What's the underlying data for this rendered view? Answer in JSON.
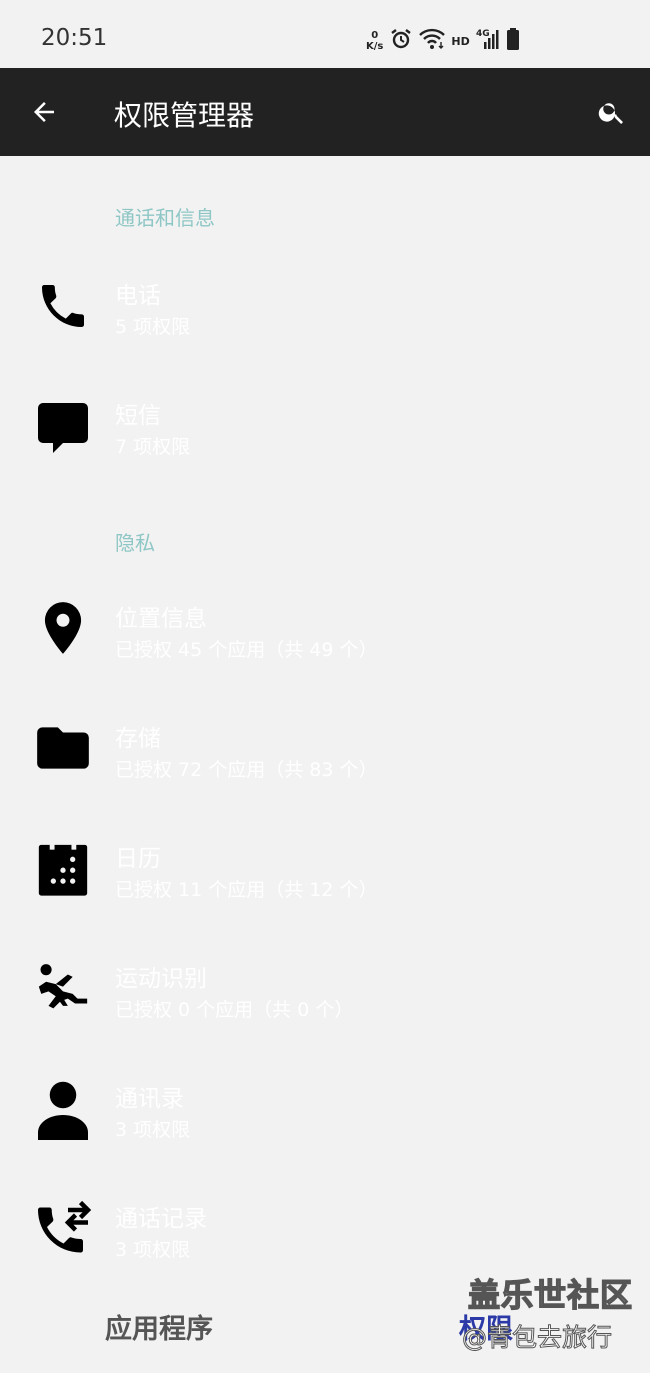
{
  "status_bar": {
    "time": "20:51",
    "net_speed_value": "0",
    "net_speed_unit": "K/s",
    "hd_label": "HD",
    "network_label": "4G"
  },
  "app_bar": {
    "title": "权限管理器",
    "background": "#222222"
  },
  "sections": [
    {
      "header": "通话和信息"
    },
    {
      "header": "隐私"
    }
  ],
  "permissions": [
    {
      "icon": "phone-icon",
      "title": "电话",
      "subtitle": "5 项权限"
    },
    {
      "icon": "sms-icon",
      "title": "短信",
      "subtitle": "7 项权限"
    },
    {
      "icon": "location-icon",
      "title": "位置信息",
      "subtitle": "已授权 45 个应用（共 49 个）"
    },
    {
      "icon": "folder-icon",
      "title": "存储",
      "subtitle": "已授权 72 个应用（共 83 个）"
    },
    {
      "icon": "calendar-icon",
      "title": "日历",
      "subtitle": "已授权 11 个应用（共 12 个）"
    },
    {
      "icon": "activity-icon",
      "title": "运动识别",
      "subtitle": "已授权 0 个应用（共 0 个）"
    },
    {
      "icon": "contacts-icon",
      "title": "通讯录",
      "subtitle": "3 项权限"
    },
    {
      "icon": "call-log-icon",
      "title": "通话记录",
      "subtitle": "3 项权限"
    }
  ],
  "footer": {
    "label": "应用程序"
  },
  "watermark": {
    "site": "盖乐世社区",
    "tag": "权限",
    "author": "@青包去旅行"
  },
  "colors": {
    "background": "#f2f2f2",
    "section_header": "#8ec7c5",
    "row_text": "#ffffff"
  }
}
